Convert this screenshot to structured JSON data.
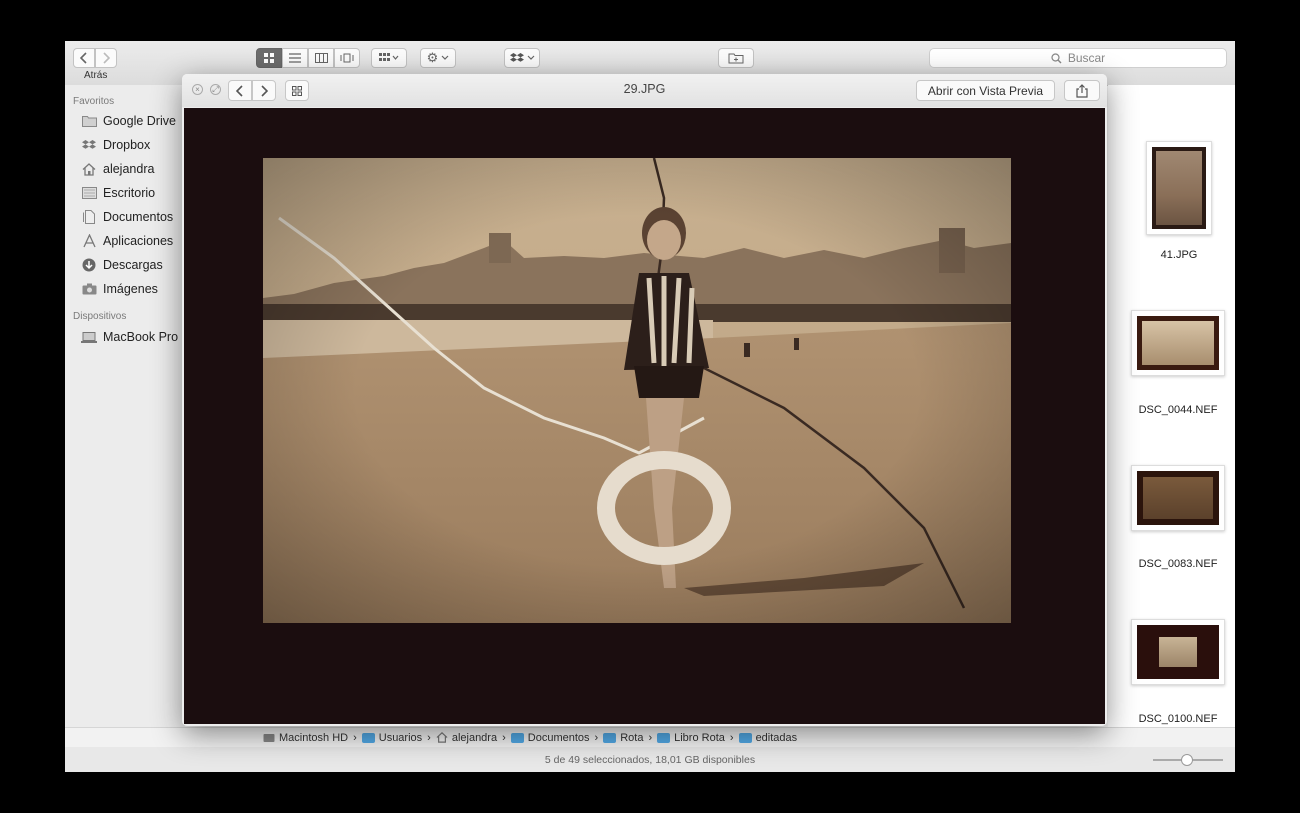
{
  "toolbar": {
    "back_label": "Atrás",
    "search_placeholder": "Buscar",
    "search_icon": "magnifier-icon"
  },
  "sidebar": {
    "favorites_header": "Favoritos",
    "favorites": [
      {
        "label": "Google Drive",
        "icon": "folder-icon"
      },
      {
        "label": "Dropbox",
        "icon": "dropbox-icon"
      },
      {
        "label": "alejandra",
        "icon": "home-icon"
      },
      {
        "label": "Escritorio",
        "icon": "desktop-icon"
      },
      {
        "label": "Documentos",
        "icon": "document-icon"
      },
      {
        "label": "Aplicaciones",
        "icon": "applications-icon"
      },
      {
        "label": "Descargas",
        "icon": "download-icon"
      },
      {
        "label": "Imágenes",
        "icon": "camera-icon"
      }
    ],
    "devices_header": "Dispositivos",
    "devices": [
      {
        "label": "MacBook Pro",
        "icon": "laptop-icon"
      }
    ]
  },
  "quicklook": {
    "filename": "29.JPG",
    "open_preview_label": "Abrir con Vista Previa",
    "share_icon": "share-icon"
  },
  "thumbnails": [
    {
      "label": "41.JPG"
    },
    {
      "label": "DSC_0044.NEF"
    },
    {
      "label": "DSC_0083.NEF"
    },
    {
      "label": "DSC_0100.NEF"
    }
  ],
  "pathbar": [
    {
      "label": "Macintosh HD",
      "icon": "hard-drive-icon"
    },
    {
      "label": "Usuarios",
      "icon": "folder-icon"
    },
    {
      "label": "alejandra",
      "icon": "home-icon"
    },
    {
      "label": "Documentos",
      "icon": "folder-icon"
    },
    {
      "label": "Rota",
      "icon": "folder-icon"
    },
    {
      "label": "Libro Rota",
      "icon": "folder-icon"
    },
    {
      "label": "editadas",
      "icon": "folder-icon"
    }
  ],
  "status": {
    "text": "5 de 49 seleccionados, 18,01 GB disponibles"
  },
  "colors": {
    "folder_blue": "#52a9e6",
    "photo_background": "#1b0d0f",
    "sepia": "#b89a76"
  }
}
